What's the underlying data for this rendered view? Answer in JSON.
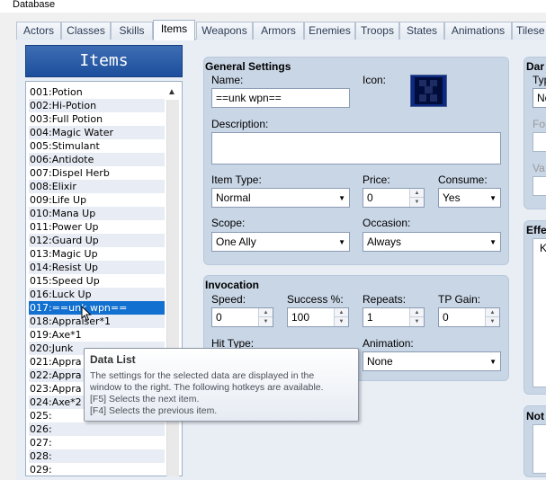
{
  "window": {
    "title": "Database"
  },
  "tabs": [
    {
      "label": "Actors",
      "active": false
    },
    {
      "label": "Classes",
      "active": false
    },
    {
      "label": "Skills",
      "active": false
    },
    {
      "label": "Items",
      "active": true
    },
    {
      "label": "Weapons",
      "active": false
    },
    {
      "label": "Armors",
      "active": false
    },
    {
      "label": "Enemies",
      "active": false
    },
    {
      "label": "Troops",
      "active": false
    },
    {
      "label": "States",
      "active": false
    },
    {
      "label": "Animations",
      "active": false
    },
    {
      "label": "Tilese",
      "active": false
    }
  ],
  "list": {
    "title": "Items",
    "selected_index": 16,
    "items": [
      "001:Potion",
      "002:Hi-Potion",
      "003:Full Potion",
      "004:Magic Water",
      "005:Stimulant",
      "006:Antidote",
      "007:Dispel Herb",
      "008:Elixir",
      "009:Life Up",
      "010:Mana Up",
      "011:Power Up",
      "012:Guard Up",
      "013:Magic Up",
      "014:Resist Up",
      "015:Speed Up",
      "016:Luck Up",
      "017:==unk wpn==",
      "018:Appraiser*1",
      "019:Axe*1",
      "020:Junk",
      "021:Appra",
      "022:Appra",
      "023:Appra",
      "024:Axe*2",
      "025:",
      "026:",
      "027:",
      "028:",
      "029:"
    ]
  },
  "general": {
    "title": "General Settings",
    "name_label": "Name:",
    "name_value": "==unk wpn==",
    "icon_label": "Icon:",
    "description_label": "Description:",
    "description_value": "",
    "item_type_label": "Item Type:",
    "item_type_value": "Normal",
    "price_label": "Price:",
    "price_value": "0",
    "consume_label": "Consume:",
    "consume_value": "Yes",
    "scope_label": "Scope:",
    "scope_value": "One Ally",
    "occasion_label": "Occasion:",
    "occasion_value": "Always"
  },
  "invocation": {
    "title": "Invocation",
    "speed_label": "Speed:",
    "speed_value": "0",
    "success_label": "Success %:",
    "success_value": "100",
    "repeats_label": "Repeats:",
    "repeats_value": "1",
    "tp_gain_label": "TP Gain:",
    "tp_gain_value": "0",
    "hit_type_label": "Hit Type:",
    "animation_label": "Animation:",
    "animation_value": "None"
  },
  "right_edge": {
    "damage_title": "Dar",
    "damage_type_label": "Typ",
    "damage_type_value": "No",
    "formula_label": "For",
    "variance_label": "Va",
    "effects_title": "Effe",
    "effects_col": "K",
    "note_title": "Not"
  },
  "tooltip": {
    "title": "Data List",
    "line1": "The settings for the selected data are displayed in the",
    "line2": "window to the right. The following hotkeys are available.",
    "line3": "[F5] Selects the next item.",
    "line4": "[F4] Selects the previous item."
  },
  "colors": {
    "selection": "#1170d0",
    "list_header": "#1c4e9c",
    "panel": "#c9d6e6"
  }
}
